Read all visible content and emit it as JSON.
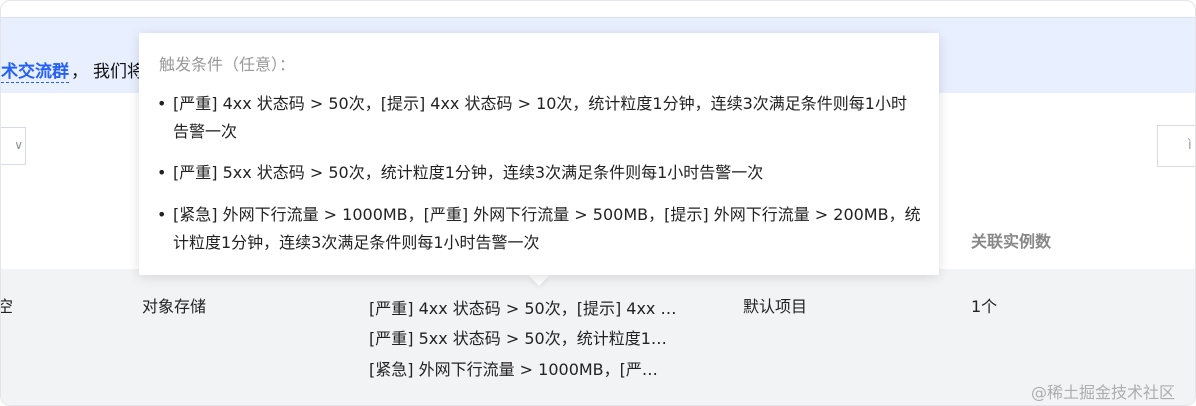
{
  "notice": {
    "link": "术交流群",
    "comma": "，",
    "text": "我们将"
  },
  "table": {
    "headers": {
      "instances": "关联实例数"
    },
    "row": {
      "name": "空",
      "type": "对象存储",
      "triggers": [
        "[严重] 4xx 状态码 > 50次，[提示] 4xx …",
        "[严重] 5xx 状态码 > 50次，统计粒度1…",
        "[紧急] 外网下行流量 > 1000MB，[严…"
      ],
      "project": "默认项目",
      "instances": "1个"
    }
  },
  "toolbar": {
    "select_suffix": "∨",
    "search_fragment": "ì"
  },
  "popover": {
    "title": "触发条件（任意）：",
    "items": [
      "[严重] 4xx 状态码 > 50次，[提示] 4xx 状态码 > 10次，统计粒度1分钟，连续3次满足条件则每1小时告警一次",
      "[严重] 5xx 状态码 > 50次，统计粒度1分钟，连续3次满足条件则每1小时告警一次",
      "[紧急] 外网下行流量 > 1000MB，[严重] 外网下行流量 > 500MB，[提示] 外网下行流量 > 200MB，统计粒度1分钟，连续3次满足条件则每1小时告警一次"
    ]
  },
  "watermark": "@稀土掘金技术社区",
  "colors": {
    "accent": "#2561f5",
    "notice_bg": "#e8efff",
    "row_bg": "#f2f3f5"
  }
}
